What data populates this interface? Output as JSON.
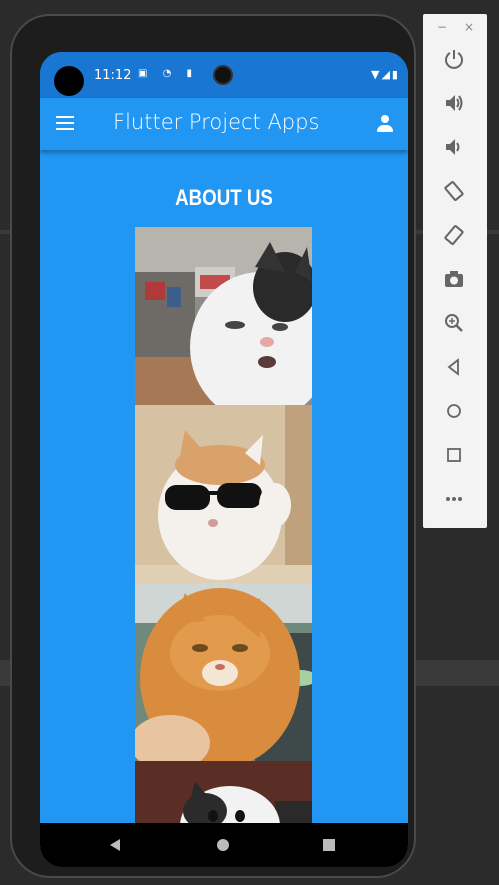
{
  "status_bar": {
    "time": "11:12",
    "left_icons": "▣ ◔ ▮",
    "right_icons": "▼◢▮"
  },
  "app_bar": {
    "title": "Flutter Project Apps"
  },
  "page": {
    "heading": "ABOUT US"
  },
  "photos": [
    {
      "name": "cat-photo-1"
    },
    {
      "name": "cat-photo-2"
    },
    {
      "name": "cat-photo-3"
    },
    {
      "name": "cat-photo-4"
    }
  ],
  "emulator_panel": {
    "minimize": "−",
    "close": "×",
    "icons": [
      "power-icon",
      "volume-up-icon",
      "volume-down-icon",
      "rotate-left-icon",
      "rotate-right-icon",
      "camera-icon",
      "zoom-icon",
      "back-icon",
      "home-icon",
      "overview-icon",
      "more-icon"
    ]
  },
  "colors": {
    "app_primary": "#2196f3",
    "status_bar": "#1976d2"
  }
}
